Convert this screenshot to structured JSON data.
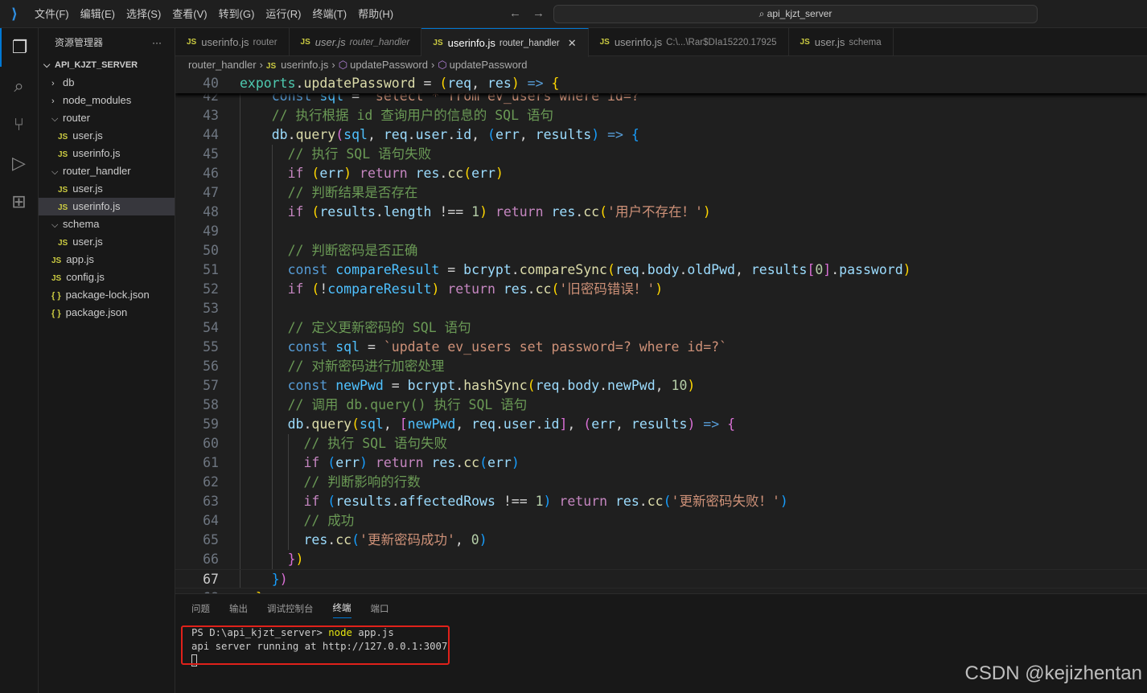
{
  "menu": [
    "文件(F)",
    "编辑(E)",
    "选择(S)",
    "查看(V)",
    "转到(G)",
    "运行(R)",
    "终端(T)",
    "帮助(H)"
  ],
  "search": "api_kjzt_server",
  "explorer": {
    "title": "资源管理器",
    "more": "···",
    "root": "API_KJZT_SERVER",
    "items": [
      {
        "type": "folder",
        "label": "db",
        "open": false,
        "depth": 0
      },
      {
        "type": "folder",
        "label": "node_modules",
        "open": false,
        "depth": 0
      },
      {
        "type": "folder",
        "label": "router",
        "open": true,
        "depth": 0
      },
      {
        "type": "js",
        "label": "user.js",
        "depth": 1
      },
      {
        "type": "js",
        "label": "userinfo.js",
        "depth": 1
      },
      {
        "type": "folder",
        "label": "router_handler",
        "open": true,
        "depth": 0
      },
      {
        "type": "js",
        "label": "user.js",
        "depth": 1
      },
      {
        "type": "js",
        "label": "userinfo.js",
        "depth": 1,
        "selected": true
      },
      {
        "type": "folder",
        "label": "schema",
        "open": true,
        "depth": 0
      },
      {
        "type": "js",
        "label": "user.js",
        "depth": 1
      },
      {
        "type": "js",
        "label": "app.js",
        "depth": 0
      },
      {
        "type": "js",
        "label": "config.js",
        "depth": 0
      },
      {
        "type": "json",
        "label": "package-lock.json",
        "depth": 0
      },
      {
        "type": "json",
        "label": "package.json",
        "depth": 0
      }
    ]
  },
  "tabs": [
    {
      "label": "userinfo.js",
      "desc": "router"
    },
    {
      "label": "user.js",
      "desc": "router_handler",
      "italic": true
    },
    {
      "label": "userinfo.js",
      "desc": "router_handler",
      "active": true
    },
    {
      "label": "userinfo.js",
      "desc": "C:\\...\\Rar$DIa15220.17925"
    },
    {
      "label": "user.js",
      "desc": "schema"
    }
  ],
  "breadcrumb": [
    "router_handler",
    "userinfo.js",
    "updatePassword",
    "updatePassword"
  ],
  "sticky": {
    "num": "40",
    "tokens": [
      [
        "exp",
        "exports"
      ],
      [
        "plain",
        "."
      ],
      [
        "fn",
        "updatePassword"
      ],
      [
        "plain",
        " = "
      ],
      [
        "p1",
        "("
      ],
      [
        "var",
        "req"
      ],
      [
        "plain",
        ", "
      ],
      [
        "var",
        "res"
      ],
      [
        "p1",
        ")"
      ],
      [
        "kw",
        " =>"
      ],
      [
        "plain",
        " "
      ],
      [
        "p1",
        "{"
      ]
    ]
  },
  "code": [
    {
      "num": "42",
      "tokens": [
        [
          "plain",
          "    "
        ],
        [
          "kw",
          "const"
        ],
        [
          "plain",
          " "
        ],
        [
          "cst",
          "sql"
        ],
        [
          "plain",
          " = "
        ],
        [
          "str",
          "`select * from ev_users where id=?`"
        ]
      ]
    },
    {
      "num": "43",
      "tokens": [
        [
          "com",
          "    // 执行根据 id 查询用户的信息的 SQL 语句"
        ]
      ]
    },
    {
      "num": "44",
      "tokens": [
        [
          "plain",
          "    "
        ],
        [
          "var",
          "db"
        ],
        [
          "plain",
          "."
        ],
        [
          "fn",
          "query"
        ],
        [
          "p2",
          "("
        ],
        [
          "cst",
          "sql"
        ],
        [
          "plain",
          ", "
        ],
        [
          "var",
          "req"
        ],
        [
          "plain",
          "."
        ],
        [
          "var",
          "user"
        ],
        [
          "plain",
          "."
        ],
        [
          "var",
          "id"
        ],
        [
          "plain",
          ", "
        ],
        [
          "p3",
          "("
        ],
        [
          "var",
          "err"
        ],
        [
          "plain",
          ", "
        ],
        [
          "var",
          "results"
        ],
        [
          "p3",
          ")"
        ],
        [
          "kw",
          " =>"
        ],
        [
          "plain",
          " "
        ],
        [
          "p3",
          "{"
        ]
      ]
    },
    {
      "num": "45",
      "tokens": [
        [
          "com",
          "      // 执行 SQL 语句失败"
        ]
      ]
    },
    {
      "num": "46",
      "tokens": [
        [
          "plain",
          "      "
        ],
        [
          "ctl",
          "if"
        ],
        [
          "plain",
          " "
        ],
        [
          "p1",
          "("
        ],
        [
          "var",
          "err"
        ],
        [
          "p1",
          ")"
        ],
        [
          "plain",
          " "
        ],
        [
          "ctl",
          "return"
        ],
        [
          "plain",
          " "
        ],
        [
          "var",
          "res"
        ],
        [
          "plain",
          "."
        ],
        [
          "fn",
          "cc"
        ],
        [
          "p1",
          "("
        ],
        [
          "var",
          "err"
        ],
        [
          "p1",
          ")"
        ]
      ]
    },
    {
      "num": "47",
      "tokens": [
        [
          "com",
          "      // 判断结果是否存在"
        ]
      ]
    },
    {
      "num": "48",
      "tokens": [
        [
          "plain",
          "      "
        ],
        [
          "ctl",
          "if"
        ],
        [
          "plain",
          " "
        ],
        [
          "p1",
          "("
        ],
        [
          "var",
          "results"
        ],
        [
          "plain",
          "."
        ],
        [
          "var",
          "length"
        ],
        [
          "plain",
          " !== "
        ],
        [
          "num",
          "1"
        ],
        [
          "p1",
          ")"
        ],
        [
          "plain",
          " "
        ],
        [
          "ctl",
          "return"
        ],
        [
          "plain",
          " "
        ],
        [
          "var",
          "res"
        ],
        [
          "plain",
          "."
        ],
        [
          "fn",
          "cc"
        ],
        [
          "p1",
          "("
        ],
        [
          "str",
          "'用户不存在！'"
        ],
        [
          "p1",
          ")"
        ]
      ]
    },
    {
      "num": "49",
      "tokens": []
    },
    {
      "num": "50",
      "tokens": [
        [
          "com",
          "      // 判断密码是否正确"
        ]
      ]
    },
    {
      "num": "51",
      "tokens": [
        [
          "plain",
          "      "
        ],
        [
          "kw",
          "const"
        ],
        [
          "plain",
          " "
        ],
        [
          "cst",
          "compareResult"
        ],
        [
          "plain",
          " = "
        ],
        [
          "var",
          "bcrypt"
        ],
        [
          "plain",
          "."
        ],
        [
          "fn",
          "compareSync"
        ],
        [
          "p1",
          "("
        ],
        [
          "var",
          "req"
        ],
        [
          "plain",
          "."
        ],
        [
          "var",
          "body"
        ],
        [
          "plain",
          "."
        ],
        [
          "var",
          "oldPwd"
        ],
        [
          "plain",
          ", "
        ],
        [
          "var",
          "results"
        ],
        [
          "p2",
          "["
        ],
        [
          "num",
          "0"
        ],
        [
          "p2",
          "]"
        ],
        [
          "plain",
          "."
        ],
        [
          "var",
          "password"
        ],
        [
          "p1",
          ")"
        ]
      ]
    },
    {
      "num": "52",
      "tokens": [
        [
          "plain",
          "      "
        ],
        [
          "ctl",
          "if"
        ],
        [
          "plain",
          " "
        ],
        [
          "p1",
          "("
        ],
        [
          "plain",
          "!"
        ],
        [
          "cst",
          "compareResult"
        ],
        [
          "p1",
          ")"
        ],
        [
          "plain",
          " "
        ],
        [
          "ctl",
          "return"
        ],
        [
          "plain",
          " "
        ],
        [
          "var",
          "res"
        ],
        [
          "plain",
          "."
        ],
        [
          "fn",
          "cc"
        ],
        [
          "p1",
          "("
        ],
        [
          "str",
          "'旧密码错误！'"
        ],
        [
          "p1",
          ")"
        ]
      ]
    },
    {
      "num": "53",
      "tokens": []
    },
    {
      "num": "54",
      "tokens": [
        [
          "com",
          "      // 定义更新密码的 SQL 语句"
        ]
      ]
    },
    {
      "num": "55",
      "tokens": [
        [
          "plain",
          "      "
        ],
        [
          "kw",
          "const"
        ],
        [
          "plain",
          " "
        ],
        [
          "cst",
          "sql"
        ],
        [
          "plain",
          " = "
        ],
        [
          "str",
          "`update ev_users set password=? where id=?`"
        ]
      ]
    },
    {
      "num": "56",
      "tokens": [
        [
          "com",
          "      // 对新密码进行加密处理"
        ]
      ]
    },
    {
      "num": "57",
      "tokens": [
        [
          "plain",
          "      "
        ],
        [
          "kw",
          "const"
        ],
        [
          "plain",
          " "
        ],
        [
          "cst",
          "newPwd"
        ],
        [
          "plain",
          " = "
        ],
        [
          "var",
          "bcrypt"
        ],
        [
          "plain",
          "."
        ],
        [
          "fn",
          "hashSync"
        ],
        [
          "p1",
          "("
        ],
        [
          "var",
          "req"
        ],
        [
          "plain",
          "."
        ],
        [
          "var",
          "body"
        ],
        [
          "plain",
          "."
        ],
        [
          "var",
          "newPwd"
        ],
        [
          "plain",
          ", "
        ],
        [
          "num",
          "10"
        ],
        [
          "p1",
          ")"
        ]
      ]
    },
    {
      "num": "58",
      "tokens": [
        [
          "com",
          "      // 调用 db.query() 执行 SQL 语句"
        ]
      ]
    },
    {
      "num": "59",
      "tokens": [
        [
          "plain",
          "      "
        ],
        [
          "var",
          "db"
        ],
        [
          "plain",
          "."
        ],
        [
          "fn",
          "query"
        ],
        [
          "p1",
          "("
        ],
        [
          "cst",
          "sql"
        ],
        [
          "plain",
          ", "
        ],
        [
          "p2",
          "["
        ],
        [
          "cst",
          "newPwd"
        ],
        [
          "plain",
          ", "
        ],
        [
          "var",
          "req"
        ],
        [
          "plain",
          "."
        ],
        [
          "var",
          "user"
        ],
        [
          "plain",
          "."
        ],
        [
          "var",
          "id"
        ],
        [
          "p2",
          "]"
        ],
        [
          "plain",
          ", "
        ],
        [
          "p2",
          "("
        ],
        [
          "var",
          "err"
        ],
        [
          "plain",
          ", "
        ],
        [
          "var",
          "results"
        ],
        [
          "p2",
          ")"
        ],
        [
          "kw",
          " =>"
        ],
        [
          "plain",
          " "
        ],
        [
          "p2",
          "{"
        ]
      ]
    },
    {
      "num": "60",
      "tokens": [
        [
          "com",
          "        // 执行 SQL 语句失败"
        ]
      ]
    },
    {
      "num": "61",
      "tokens": [
        [
          "plain",
          "        "
        ],
        [
          "ctl",
          "if"
        ],
        [
          "plain",
          " "
        ],
        [
          "p3",
          "("
        ],
        [
          "var",
          "err"
        ],
        [
          "p3",
          ")"
        ],
        [
          "plain",
          " "
        ],
        [
          "ctl",
          "return"
        ],
        [
          "plain",
          " "
        ],
        [
          "var",
          "res"
        ],
        [
          "plain",
          "."
        ],
        [
          "fn",
          "cc"
        ],
        [
          "p3",
          "("
        ],
        [
          "var",
          "err"
        ],
        [
          "p3",
          ")"
        ]
      ]
    },
    {
      "num": "62",
      "tokens": [
        [
          "com",
          "        // 判断影响的行数"
        ]
      ]
    },
    {
      "num": "63",
      "tokens": [
        [
          "plain",
          "        "
        ],
        [
          "ctl",
          "if"
        ],
        [
          "plain",
          " "
        ],
        [
          "p3",
          "("
        ],
        [
          "var",
          "results"
        ],
        [
          "plain",
          "."
        ],
        [
          "var",
          "affectedRows"
        ],
        [
          "plain",
          " !== "
        ],
        [
          "num",
          "1"
        ],
        [
          "p3",
          ")"
        ],
        [
          "plain",
          " "
        ],
        [
          "ctl",
          "return"
        ],
        [
          "plain",
          " "
        ],
        [
          "var",
          "res"
        ],
        [
          "plain",
          "."
        ],
        [
          "fn",
          "cc"
        ],
        [
          "p3",
          "("
        ],
        [
          "str",
          "'更新密码失败！'"
        ],
        [
          "p3",
          ")"
        ]
      ]
    },
    {
      "num": "64",
      "tokens": [
        [
          "com",
          "        // 成功"
        ]
      ]
    },
    {
      "num": "65",
      "tokens": [
        [
          "plain",
          "        "
        ],
        [
          "var",
          "res"
        ],
        [
          "plain",
          "."
        ],
        [
          "fn",
          "cc"
        ],
        [
          "p3",
          "("
        ],
        [
          "str",
          "'更新密码成功'"
        ],
        [
          "plain",
          ", "
        ],
        [
          "num",
          "0"
        ],
        [
          "p3",
          ")"
        ]
      ]
    },
    {
      "num": "66",
      "tokens": [
        [
          "plain",
          "      "
        ],
        [
          "p2",
          "}"
        ],
        [
          "p1",
          ")"
        ]
      ]
    },
    {
      "num": "67",
      "current": true,
      "tokens": [
        [
          "plain",
          "    "
        ],
        [
          "p3",
          "}"
        ],
        [
          "p2",
          ")"
        ]
      ]
    },
    {
      "num": "68",
      "tokens": [
        [
          "plain",
          "  "
        ],
        [
          "p1",
          "}"
        ]
      ]
    }
  ],
  "panel": {
    "tabs": [
      "问题",
      "输出",
      "调试控制台",
      "终端",
      "端口"
    ],
    "active": 3,
    "terminal": {
      "prompt": "PS D:\\api_kjzt_server> ",
      "cmd": "node",
      "args": " app.js",
      "output": "api server running at http://127.0.0.1:3007"
    }
  },
  "watermark": "CSDN @kejizhentan"
}
